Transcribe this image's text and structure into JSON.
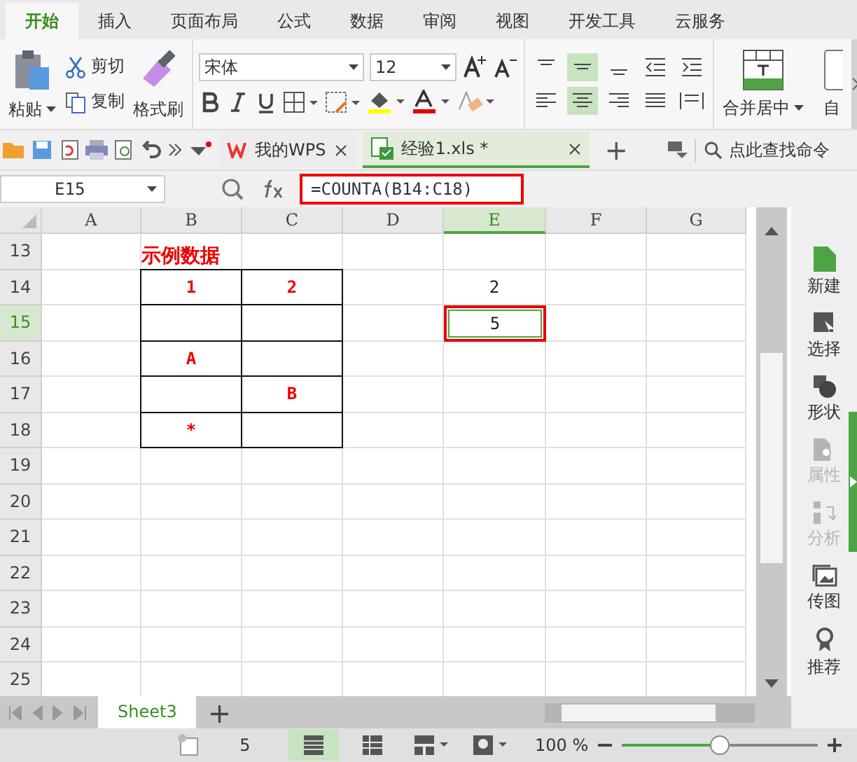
{
  "menu_tabs": [
    {
      "label": "开始",
      "selected": true
    },
    {
      "label": "插入",
      "selected": false
    },
    {
      "label": "页面布局",
      "selected": false
    },
    {
      "label": "公式",
      "selected": false
    },
    {
      "label": "数据",
      "selected": false
    },
    {
      "label": "审阅",
      "selected": false
    },
    {
      "label": "视图",
      "selected": false
    },
    {
      "label": "开发工具",
      "selected": false
    },
    {
      "label": "云服务",
      "selected": false
    }
  ],
  "ribbon": {
    "paste": "粘贴",
    "cut": "剪切",
    "copy": "复制",
    "format_painter": "格式刷",
    "font_name": "宋体",
    "font_size": "12",
    "align_top": [
      {
        "selected": false
      },
      {
        "selected": true
      },
      {
        "selected": false
      }
    ],
    "align_bottom": [
      {
        "selected": false
      },
      {
        "selected": true
      },
      {
        "selected": false
      },
      {
        "selected": false
      }
    ],
    "merge": "合并居中",
    "auto": "自"
  },
  "doc_tabs": [
    {
      "label": "我的WPS",
      "selected": false
    },
    {
      "label": "经验1.xls *",
      "selected": true
    }
  ],
  "new_tab": "+",
  "command_search": "点此查找命令",
  "name_box": "E15",
  "formula": "=COUNTA(B14:C18)",
  "columns": [
    {
      "label": "A",
      "selected": false
    },
    {
      "label": "B",
      "selected": false
    },
    {
      "label": "C",
      "selected": false
    },
    {
      "label": "D",
      "selected": false
    },
    {
      "label": "E",
      "selected": true
    },
    {
      "label": "F",
      "selected": false
    },
    {
      "label": "G",
      "selected": false
    }
  ],
  "rows": [
    {
      "label": "13",
      "selected": false,
      "cells": [
        null,
        {
          "text": "示例数据",
          "kind": "title",
          "bordered": false,
          "selected": false
        },
        null,
        null,
        null,
        null,
        null
      ]
    },
    {
      "label": "14",
      "selected": false,
      "cells": [
        null,
        {
          "text": "1",
          "kind": "red",
          "bordered": true,
          "selected": false
        },
        {
          "text": "2",
          "kind": "red",
          "bordered": true,
          "selected": false
        },
        null,
        {
          "text": "2",
          "kind": "plain",
          "bordered": false,
          "selected": false
        },
        null,
        null
      ]
    },
    {
      "label": "15",
      "selected": true,
      "cells": [
        null,
        {
          "bordered": true,
          "selected": false
        },
        {
          "bordered": true,
          "selected": false
        },
        null,
        {
          "text": "5",
          "kind": "plain",
          "bordered": false,
          "selected": true
        },
        null,
        null
      ]
    },
    {
      "label": "16",
      "selected": false,
      "cells": [
        null,
        {
          "text": "A",
          "kind": "red",
          "bordered": true,
          "selected": false
        },
        {
          "bordered": true,
          "selected": false
        },
        null,
        null,
        null,
        null
      ]
    },
    {
      "label": "17",
      "selected": false,
      "cells": [
        null,
        {
          "bordered": true,
          "selected": false
        },
        {
          "text": "B",
          "kind": "red",
          "bordered": true,
          "selected": false
        },
        null,
        null,
        null,
        null
      ]
    },
    {
      "label": "18",
      "selected": false,
      "cells": [
        null,
        {
          "text": "*",
          "kind": "red",
          "bordered": true,
          "selected": false
        },
        {
          "bordered": true,
          "selected": false
        },
        null,
        null,
        null,
        null
      ]
    },
    {
      "label": "19",
      "selected": false,
      "cells": [
        null,
        null,
        null,
        null,
        null,
        null,
        null
      ]
    },
    {
      "label": "20",
      "selected": false,
      "cells": [
        null,
        null,
        null,
        null,
        null,
        null,
        null
      ]
    },
    {
      "label": "21",
      "selected": false,
      "cells": [
        null,
        null,
        null,
        null,
        null,
        null,
        null
      ]
    },
    {
      "label": "22",
      "selected": false,
      "cells": [
        null,
        null,
        null,
        null,
        null,
        null,
        null
      ]
    },
    {
      "label": "23",
      "selected": false,
      "cells": [
        null,
        null,
        null,
        null,
        null,
        null,
        null
      ]
    },
    {
      "label": "24",
      "selected": false,
      "cells": [
        null,
        null,
        null,
        null,
        null,
        null,
        null
      ]
    },
    {
      "label": "25",
      "selected": false,
      "cells": [
        null,
        null,
        null,
        null,
        null,
        null,
        null
      ]
    }
  ],
  "side_panel": [
    {
      "label": "新建",
      "kind": "new",
      "disabled": false
    },
    {
      "label": "选择",
      "kind": "select",
      "disabled": false
    },
    {
      "label": "形状",
      "kind": "shape",
      "disabled": false
    },
    {
      "label": "属性",
      "kind": "props",
      "disabled": true
    },
    {
      "label": "分析",
      "kind": "analyze",
      "disabled": true
    },
    {
      "label": "传图",
      "kind": "image",
      "disabled": false
    },
    {
      "label": "推荐",
      "kind": "recommend",
      "disabled": false
    }
  ],
  "sheet_tabs": [
    {
      "label": "Sheet3",
      "selected": true
    }
  ],
  "add_sheet": "+",
  "status": {
    "count": "5",
    "zoom": "100 %",
    "zoom_level": {
      "level": 0.5
    }
  }
}
